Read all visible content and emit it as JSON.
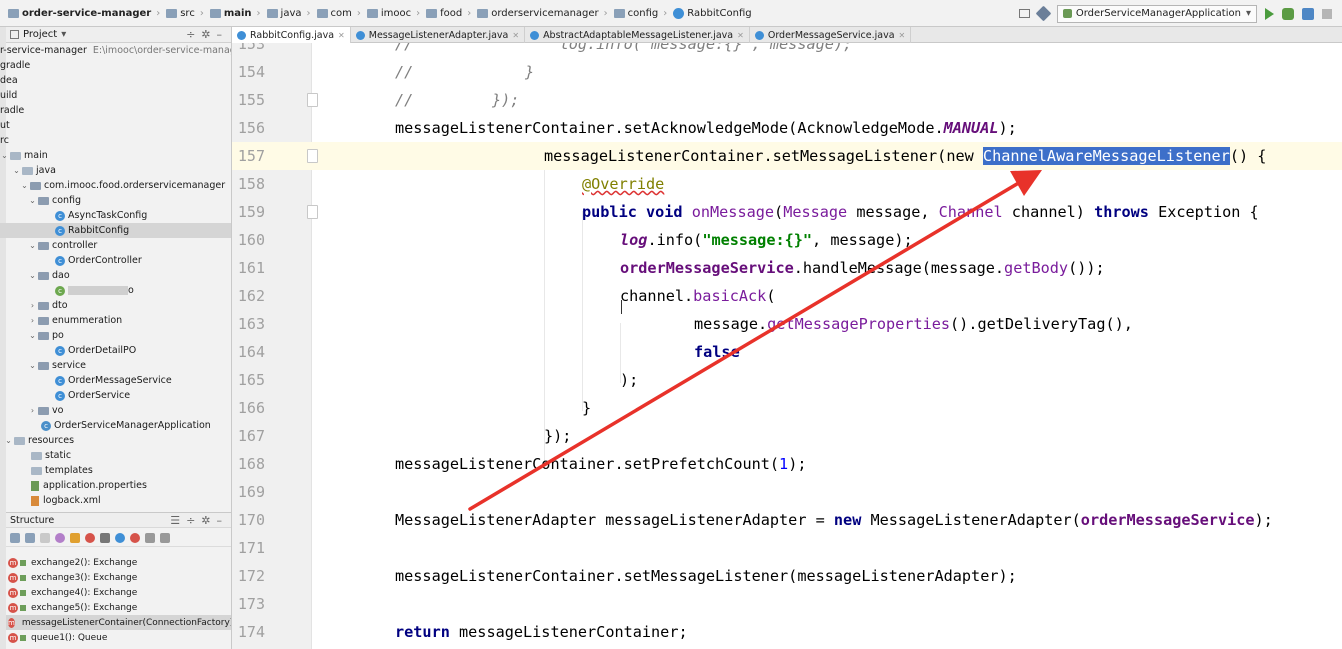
{
  "breadcrumbs": [
    "order-service-manager",
    "src",
    "main",
    "java",
    "com",
    "imooc",
    "food",
    "orderservicemanager",
    "config",
    "RabbitConfig"
  ],
  "run_config": "OrderServiceManagerApplication",
  "project_panel": {
    "title": "Project",
    "tree": [
      {
        "label": "r-service-manager",
        "hint": "E:\\imooc\\order-service-manager"
      },
      {
        "label": "gradle"
      },
      {
        "label": "dea"
      },
      {
        "label": "uild"
      },
      {
        "label": "radle"
      },
      {
        "label": "ut"
      },
      {
        "label": "rc"
      },
      {
        "label": "main"
      },
      {
        "label": "java"
      },
      {
        "label": "com.imooc.food.orderservicemanager"
      },
      {
        "label": "config"
      },
      {
        "label": "AsyncTaskConfig"
      },
      {
        "label": "RabbitConfig"
      },
      {
        "label": "controller"
      },
      {
        "label": "OrderController"
      },
      {
        "label": "dao"
      },
      {
        "label": "o"
      },
      {
        "label": "dto"
      },
      {
        "label": "enummeration"
      },
      {
        "label": "po"
      },
      {
        "label": "OrderDetailPO"
      },
      {
        "label": "service"
      },
      {
        "label": "OrderMessageService"
      },
      {
        "label": "OrderService"
      },
      {
        "label": "vo"
      },
      {
        "label": "OrderServiceManagerApplication"
      },
      {
        "label": "resources"
      },
      {
        "label": "static"
      },
      {
        "label": "templates"
      },
      {
        "label": "application.properties"
      },
      {
        "label": "logback.xml"
      }
    ]
  },
  "structure_panel": {
    "title": "Structure",
    "items": [
      "exchange2(): Exchange",
      "exchange3(): Exchange",
      "exchange4(): Exchange",
      "exchange5(): Exchange",
      "messageListenerContainer(ConnectionFactory): S",
      "queue1(): Queue"
    ]
  },
  "tabs": [
    "RabbitConfig.java",
    "MessageListenerAdapter.java",
    "AbstractAdaptableMessageListener.java",
    "OrderMessageService.java"
  ],
  "code": {
    "line_numbers": [
      "153",
      "154",
      "155",
      "156",
      "157",
      "158",
      "159",
      "160",
      "161",
      "162",
      "163",
      "164",
      "165",
      "166",
      "167",
      "168",
      "169",
      "170",
      "171",
      "172",
      "173",
      "174"
    ],
    "l153": "//                log.info(\"message:{}\", message);",
    "l154a": "//",
    "l154b": "}",
    "l155a": "//",
    "l155b": "});",
    "l156a": "messageListenerContainer.setAcknowledgeMode(AcknowledgeMode.",
    "l156b": "MANUAL",
    "l156c": ");",
    "l157a": "messageListenerContainer.setMessageListener(",
    "l157b": "new",
    "l157c": " ",
    "l157d": "ChannelAwareMessageListener",
    "l157e": "() {",
    "l158": "@Override",
    "l159a": "public void",
    "l159b": " onMessage",
    "l159c": "(",
    "l159d": "Message",
    "l159e": " message, ",
    "l159f": "Channel",
    "l159g": " channel) ",
    "l159h": "throws",
    "l159i": " Exception {",
    "l160a": "log",
    "l160b": ".info(",
    "l160c": "\"message:{}\"",
    "l160d": ", message);",
    "l161a": "orderMessageService",
    "l161b": ".handleMessage(message.",
    "l161c": "getBody",
    "l161d": "());",
    "l162a": "channel.",
    "l162b": "basicAck",
    "l162c": "(",
    "l163a": "message.",
    "l163b": "getMessageProperties",
    "l163c": "().getDeliveryTag(),",
    "l164": "false",
    "l165": ");",
    "l166": "}",
    "l167": "});",
    "l168a": "messageListenerContainer.setPrefetchCount(",
    "l168b": "1",
    "l168c": ");",
    "l170a": "MessageListenerAdapter messageListenerAdapter = ",
    "l170b": "new",
    "l170c": " MessageListenerAdapter(",
    "l170d": "orderMessageService",
    "l170e": ");",
    "l172": "messageListenerContainer.setMessageListener(messageListenerAdapter);",
    "l174a": "return",
    "l174b": " messageListenerContainer;"
  },
  "colors": {
    "annotation_arrow": "#e8322a",
    "selection": "#3d6fc9",
    "current_line": "#fffbe6"
  }
}
